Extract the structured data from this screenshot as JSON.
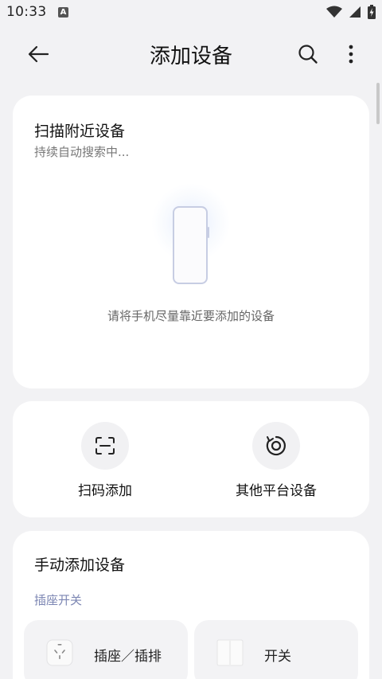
{
  "status_bar": {
    "time": "10:33",
    "notification_icon": "A"
  },
  "header": {
    "title": "添加设备",
    "back_icon": "arrow-left-icon",
    "search_icon": "search-icon",
    "more_icon": "more-vertical-icon"
  },
  "scan_card": {
    "title": "扫描附近设备",
    "subtitle": "持续自动搜索中...",
    "hint": "请将手机尽量靠近要添加的设备"
  },
  "quick_actions": [
    {
      "label": "扫码添加",
      "icon": "scan-qr-icon"
    },
    {
      "label": "其他平台设备",
      "icon": "other-platform-icon"
    }
  ],
  "manual_card": {
    "title": "手动添加设备",
    "section_label": "插座开关",
    "devices": [
      {
        "label": "插座／插排",
        "icon": "socket-icon"
      },
      {
        "label": "开关",
        "icon": "wall-switch-icon"
      }
    ]
  },
  "colors": {
    "background": "#f2f2f4",
    "card": "#ffffff",
    "section_label": "#7c86b3",
    "phone_outline": "#c7cde3"
  }
}
